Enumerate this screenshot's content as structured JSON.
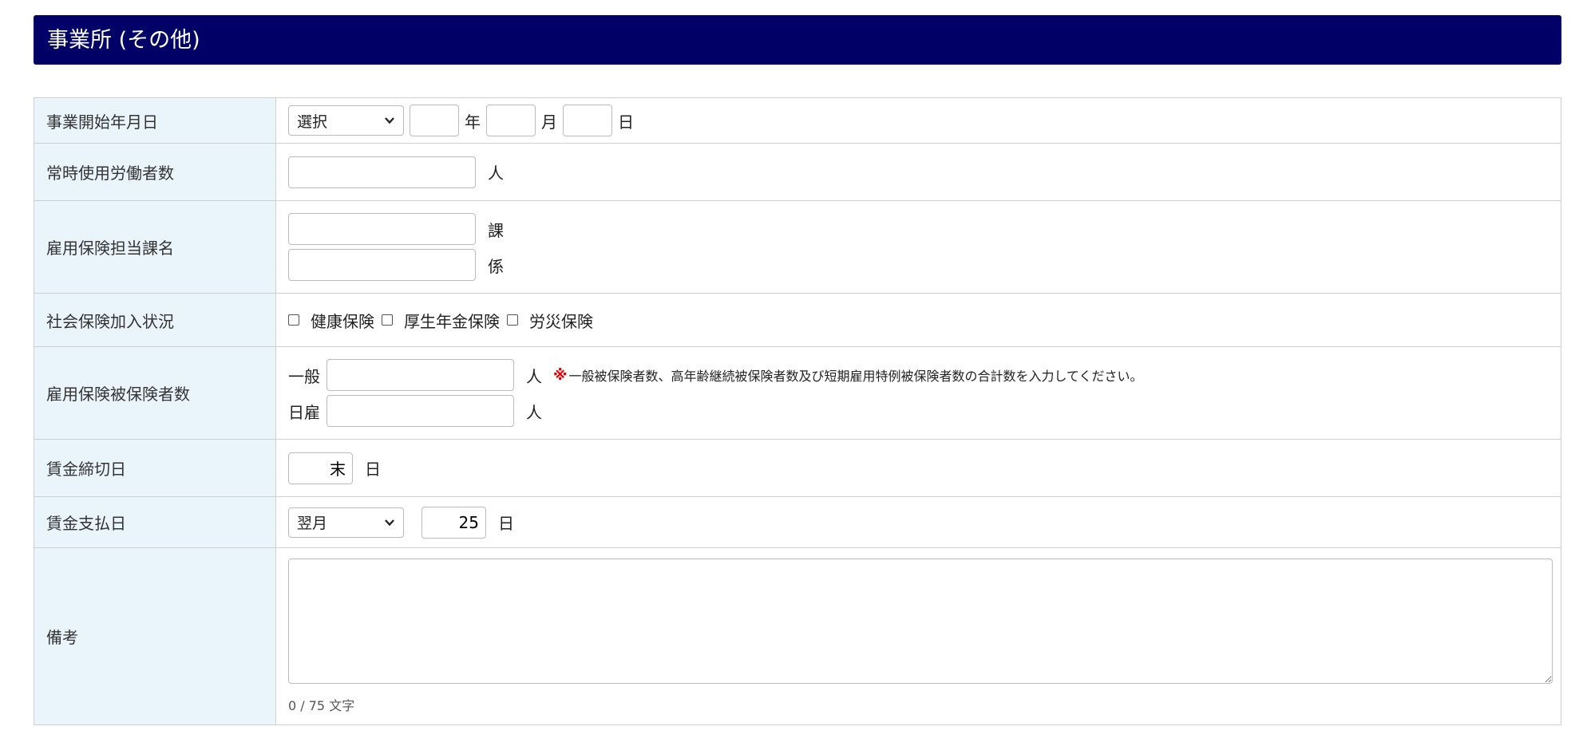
{
  "section": {
    "title": "事業所 (その他)"
  },
  "rows": {
    "business_start_date": {
      "label": "事業開始年月日",
      "era_select_value": "選択",
      "year_value": "",
      "year_unit": "年",
      "month_value": "",
      "month_unit": "月",
      "day_value": "",
      "day_unit": "日"
    },
    "regular_workers": {
      "label": "常時使用労働者数",
      "value": "",
      "unit": "人"
    },
    "employment_insurance_section": {
      "label": "雇用保険担当課名",
      "section_value": "",
      "section_unit": "課",
      "subsection_value": "",
      "subsection_unit": "係"
    },
    "social_insurance": {
      "label": "社会保険加入状況",
      "options": [
        "健康保険",
        "厚生年金保険",
        "労災保険"
      ]
    },
    "insured_count": {
      "label": "雇用保険被保険者数",
      "general_label": "一般",
      "general_value": "",
      "general_unit": "人",
      "note_mark": "※",
      "note_text": "一般被保険者数、高年齢継続被保険者数及び短期雇用特例被保険者数の合計数を入力してください。",
      "daily_label": "日雇",
      "daily_value": "",
      "daily_unit": "人"
    },
    "wage_closing_day": {
      "label": "賃金締切日",
      "value": "末",
      "unit": "日"
    },
    "wage_payment_day": {
      "label": "賃金支払日",
      "month_select_value": "翌月",
      "day_value": "25",
      "unit": "日"
    },
    "remarks": {
      "label": "備考",
      "value": "",
      "counter": "0 / 75 文字"
    }
  },
  "colors": {
    "header_bg": "#000066",
    "label_bg": "#eaf4fb",
    "border": "#cfcfcf",
    "note_mark": "#dd0000"
  },
  "icons": {
    "select_arrow": "chevron-down-icon"
  }
}
